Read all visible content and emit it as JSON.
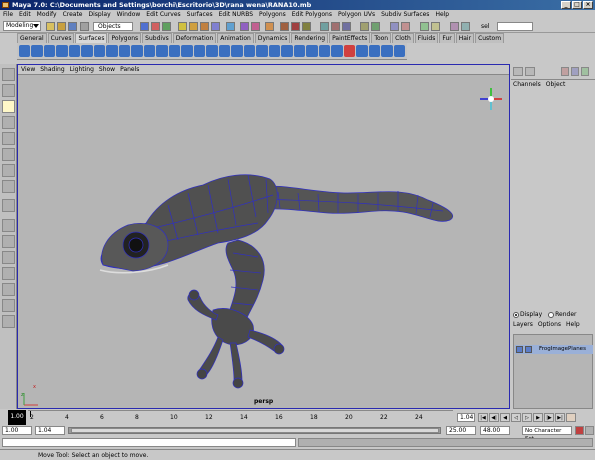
{
  "window": {
    "title": "Maya 7.0: C:\\Documents and Settings\\borchi\\Escritorio\\3D\\rana wena\\RANA10.mb",
    "buttons": [
      "_",
      "□",
      "×"
    ]
  },
  "menubar": [
    "File",
    "Edit",
    "Modify",
    "Create",
    "Display",
    "Window",
    "Edit Curves",
    "Surfaces",
    "Edit NURBS",
    "Polygons",
    "Edit Polygons",
    "Polygon UVs",
    "Subdiv Surfaces",
    "Help"
  ],
  "statusline": {
    "menuset": "Modeling",
    "objects_label": "Objects",
    "sel_label": "sel",
    "sel_value": ""
  },
  "shelf_tabs": [
    "General",
    "Curves",
    "Surfaces",
    "Polygons",
    "Subdivs",
    "Deformation",
    "Animation",
    "Dynamics",
    "Rendering",
    "PaintEffects",
    "Toon",
    "Cloth",
    "Fluids",
    "Fur",
    "Hair",
    "Custom"
  ],
  "shelf_active": "Surfaces",
  "viewport": {
    "menu": [
      "View",
      "Shading",
      "Lighting",
      "Show",
      "Panels"
    ],
    "camera": "persp",
    "axis_x": "x",
    "axis_z": "z"
  },
  "channelbox": {
    "menu": [
      "Channels",
      "Object"
    ]
  },
  "layers": {
    "display_label": "Display",
    "render_label": "Render",
    "menu": [
      "Layers",
      "Options",
      "Help"
    ],
    "items": [
      {
        "v": "V",
        "name": "FrogImagePlanes"
      }
    ]
  },
  "timeline": {
    "ticks": [
      "2",
      "4",
      "6",
      "8",
      "10",
      "12",
      "14",
      "16",
      "18",
      "20",
      "22",
      "24"
    ],
    "current_frame_box": "1.00",
    "current_frame": "1.04",
    "start": "1.00",
    "range_start": "1.04",
    "range_end": "25.00",
    "end": "48.00",
    "character_set": "No Character Set"
  },
  "helpline": "Move Tool: Select an object to move."
}
